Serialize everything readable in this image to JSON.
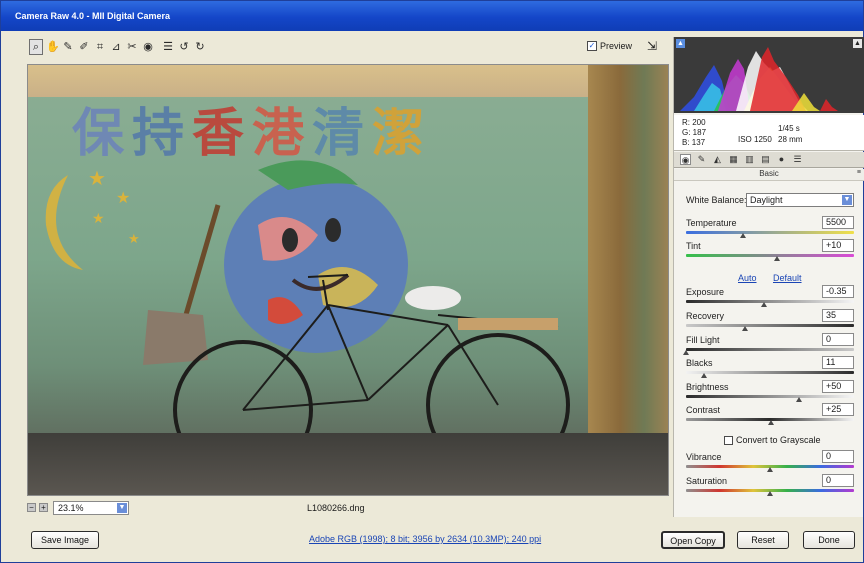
{
  "window": {
    "title": "Camera Raw 4.0  -  MII Digital Camera"
  },
  "toolbar": {
    "tools": [
      {
        "name": "zoom-tool",
        "glyph": "⌕",
        "active": true
      },
      {
        "name": "hand-tool",
        "glyph": "✋",
        "active": false
      },
      {
        "name": "white-balance-tool",
        "glyph": "✎",
        "active": false
      },
      {
        "name": "color-sampler-tool",
        "glyph": "✐",
        "active": false
      },
      {
        "name": "crop-tool",
        "glyph": "⌗",
        "active": false
      },
      {
        "name": "straighten-tool",
        "glyph": "⊿",
        "active": false
      },
      {
        "name": "retouch-tool",
        "glyph": "✂",
        "active": false
      },
      {
        "name": "red-eye-tool",
        "glyph": "◉",
        "active": false
      },
      {
        "name": "preferences-tool",
        "glyph": "☰",
        "active": false
      },
      {
        "name": "rotate-left-tool",
        "glyph": "↺",
        "active": false
      },
      {
        "name": "rotate-right-tool",
        "glyph": "↻",
        "active": false
      }
    ],
    "preview_label": "Preview",
    "preview_checked": true
  },
  "image": {
    "mural_characters": [
      {
        "char": "保",
        "color": "#6f88b4"
      },
      {
        "char": "持",
        "color": "#5a7fa6"
      },
      {
        "char": "香",
        "color": "#b94a3e"
      },
      {
        "char": "港",
        "color": "#c8624f"
      },
      {
        "char": "清",
        "color": "#5e8aa8"
      },
      {
        "char": "潔",
        "color": "#d0a23a"
      }
    ]
  },
  "zoom": {
    "minus": "−",
    "plus": "+",
    "value": "23.1%"
  },
  "file": {
    "name": "L1080266.dng"
  },
  "histogram": {
    "colors": {
      "red": "#e0262a",
      "green": "#27c24a",
      "blue": "#2f4fe6",
      "yellow": "#f0e23a",
      "magenta": "#c73ad3",
      "cyan": "#37c6e6",
      "white": "#ffffff"
    }
  },
  "readout": {
    "r": "R: 200",
    "g": "G: 187",
    "b": "B: 137",
    "shutter": "1/45 s",
    "iso": "ISO 1250",
    "focal": "28 mm"
  },
  "panel_tabs": [
    "basic",
    "tone-curve",
    "detail",
    "hsl",
    "split-toning",
    "lens",
    "calibration",
    "presets"
  ],
  "basic": {
    "title": "Basic",
    "white_balance_label": "White Balance:",
    "white_balance_value": "Daylight",
    "temperature_label": "Temperature",
    "temperature_value": "5500",
    "tint_label": "Tint",
    "tint_value": "+10",
    "auto_label": "Auto",
    "default_label": "Default",
    "exposure_label": "Exposure",
    "exposure_value": "-0.35",
    "recovery_label": "Recovery",
    "recovery_value": "35",
    "fill_light_label": "Fill Light",
    "fill_light_value": "0",
    "blacks_label": "Blacks",
    "blacks_value": "11",
    "brightness_label": "Brightness",
    "brightness_value": "+50",
    "contrast_label": "Contrast",
    "contrast_value": "+25",
    "grayscale_label": "Convert to Grayscale",
    "vibrance_label": "Vibrance",
    "vibrance_value": "0",
    "saturation_label": "Saturation",
    "saturation_value": "0"
  },
  "footer": {
    "save_label": "Save Image",
    "workflow_link": "Adobe RGB (1998); 8 bit; 3956 by 2634 (10.3MP); 240 ppi",
    "open_label": "Open Copy",
    "reset_label": "Reset",
    "done_label": "Done"
  }
}
